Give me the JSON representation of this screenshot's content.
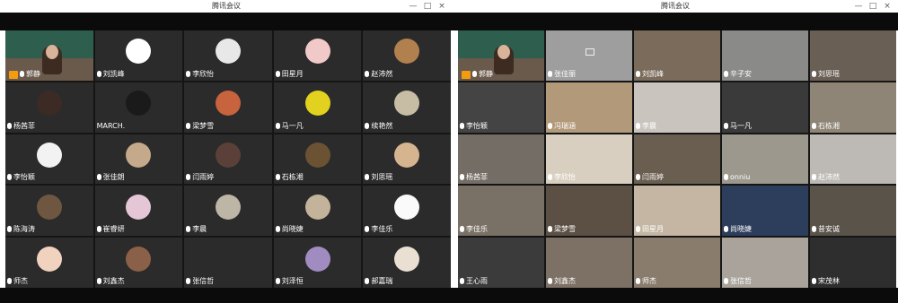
{
  "left_window": {
    "title": "腾讯会议",
    "controls": [
      "—",
      "□",
      "×"
    ],
    "participants": [
      {
        "name": "郭静",
        "host": true,
        "color": "#2e5f4e"
      },
      {
        "name": "刘凯峰",
        "color": "#ffffff"
      },
      {
        "name": "李欣怡",
        "color": "#e8e8e8"
      },
      {
        "name": "田星月",
        "color": "#f1c9c9"
      },
      {
        "name": "赵沛然",
        "color": "#b0804f"
      },
      {
        "name": "杨茜菲",
        "color": "#3c2a25"
      },
      {
        "name": "MARCH.",
        "color": "#1a1a1a"
      },
      {
        "name": "梁梦雪",
        "color": "#c7633d"
      },
      {
        "name": "马一凡",
        "color": "#e2d21f"
      },
      {
        "name": "续艳然",
        "color": "#c7bda5"
      },
      {
        "name": "李怡颖",
        "color": "#f2f2f2"
      },
      {
        "name": "张佳朗",
        "color": "#c4a98a"
      },
      {
        "name": "闫雨婷",
        "color": "#5a4038"
      },
      {
        "name": "石栋湘",
        "color": "#6b5233"
      },
      {
        "name": "刘思瑶",
        "color": "#d6b48f"
      },
      {
        "name": "陈海涛",
        "color": "#6f5640"
      },
      {
        "name": "崔睿妍",
        "color": "#e5c6d6"
      },
      {
        "name": "李晨",
        "color": "#bdb5a6"
      },
      {
        "name": "尚晓婕",
        "color": "#c4b39b"
      },
      {
        "name": "李佳乐",
        "color": "#fafafa"
      },
      {
        "name": "师杰",
        "color": "#f0d2bf"
      },
      {
        "name": "刘鑫杰",
        "color": "#8a6048"
      },
      {
        "name": "张信哲",
        "color": "#2b2b2b"
      },
      {
        "name": "刘泽恒",
        "color": "#a08cc0"
      },
      {
        "name": "郝嘉瑞",
        "color": "#e9e0d3"
      }
    ]
  },
  "right_window": {
    "title": "腾讯会议",
    "controls": [
      "—",
      "□",
      "×"
    ],
    "participants": [
      {
        "name": "郭静",
        "host": true,
        "color": "#2e5f4e"
      },
      {
        "name": "张佳丽",
        "camoff": true,
        "color": "#9e9e9e"
      },
      {
        "name": "刘凯峰",
        "color": "#7a6b5a"
      },
      {
        "name": "辛子安",
        "color": "#8a8a88"
      },
      {
        "name": "刘思瑶",
        "color": "#6a5f55"
      },
      {
        "name": "李怡颖",
        "color": "#444444"
      },
      {
        "name": "冯瑞涵",
        "color": "#b19979"
      },
      {
        "name": "李晨",
        "color": "#c9c4bd"
      },
      {
        "name": "马一凡",
        "color": "#3a3a3a"
      },
      {
        "name": "石栋湘",
        "color": "#8e8576"
      },
      {
        "name": "杨茜菲",
        "color": "#746d66"
      },
      {
        "name": "李欣怡",
        "color": "#d8cfc0"
      },
      {
        "name": "闫雨婷",
        "color": "#6a5e50"
      },
      {
        "name": "onniu",
        "color": "#9c988e"
      },
      {
        "name": "赵沛然",
        "color": "#bdbab6"
      },
      {
        "name": "李佳乐",
        "color": "#7a7166"
      },
      {
        "name": "梁梦雪",
        "color": "#5c5045"
      },
      {
        "name": "田星月",
        "color": "#c5b6a4"
      },
      {
        "name": "尚晓婕",
        "color": "#2c3e5c"
      },
      {
        "name": "昔安诚",
        "color": "#5a5349"
      },
      {
        "name": "王心雨",
        "color": "#3b3b3b"
      },
      {
        "name": "刘鑫杰",
        "color": "#7d7064"
      },
      {
        "name": "师杰",
        "color": "#8a7c6c"
      },
      {
        "name": "张信哲",
        "color": "#a9a39b"
      },
      {
        "name": "宋茂林",
        "color": "#2e2e2e"
      }
    ]
  }
}
